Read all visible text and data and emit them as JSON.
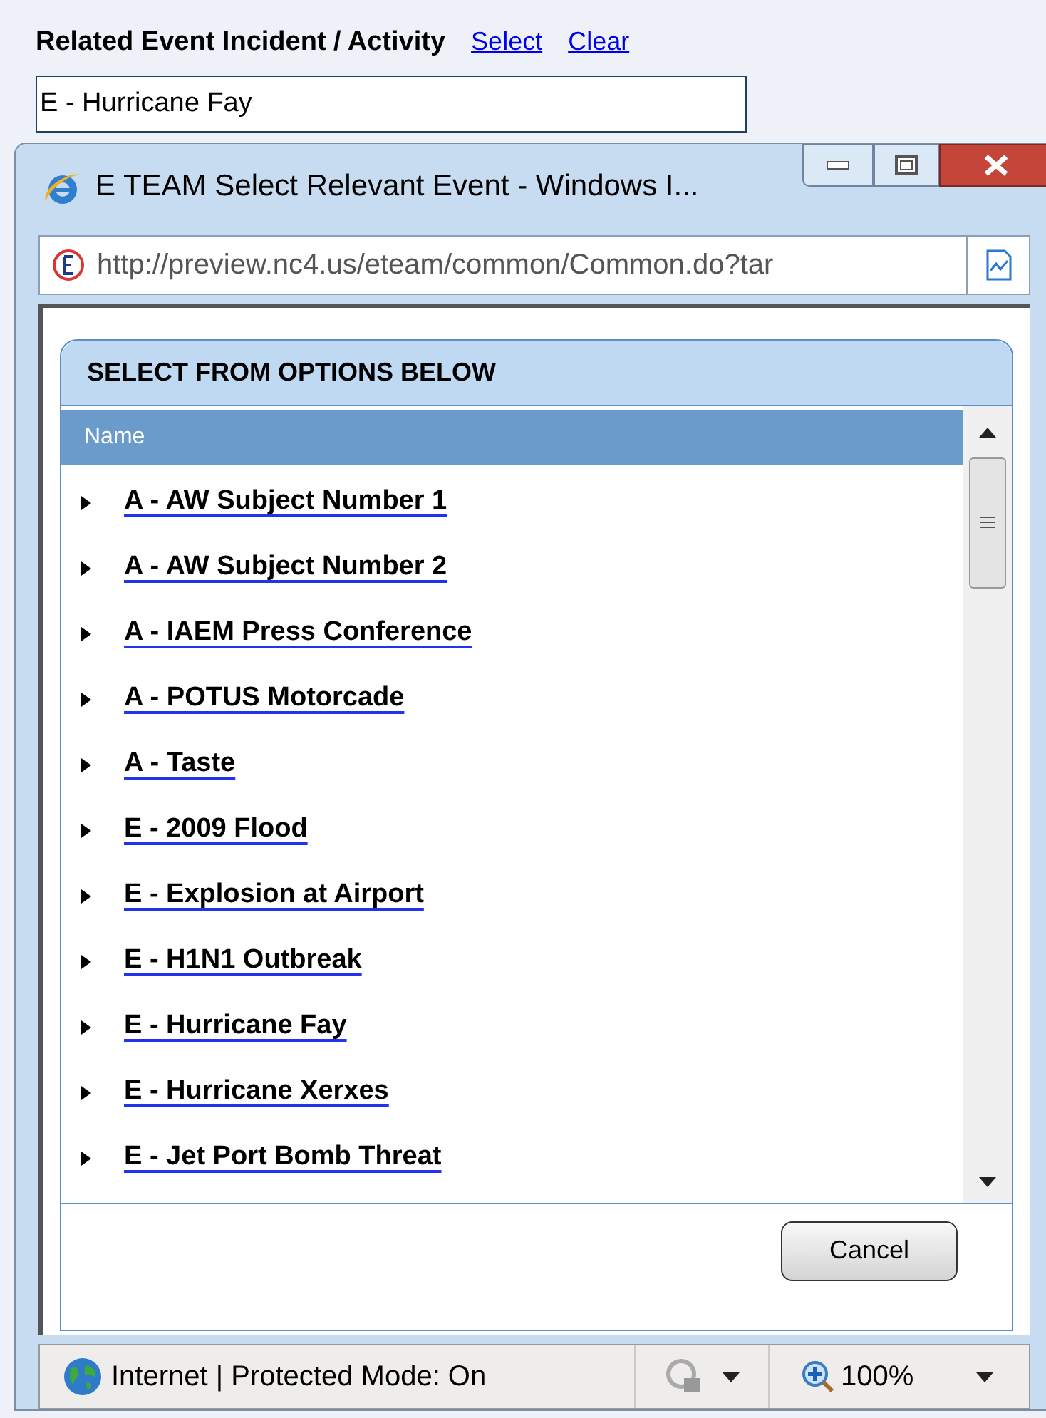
{
  "form": {
    "label": "Related Event Incident / Activity",
    "links": [
      "Select",
      "Clear"
    ],
    "value": "E - Hurricane Fay"
  },
  "window": {
    "title": "E TEAM Select Relevant Event - Windows I...",
    "address": "http://preview.nc4.us/eteam/common/Common.do?tar"
  },
  "panel": {
    "title": "SELECT FROM OPTIONS BELOW",
    "column": "Name",
    "items": [
      {
        "label": "A - AW Subject Number 1",
        "expanded": false
      },
      {
        "label": "A - AW Subject Number 2",
        "expanded": false
      },
      {
        "label": "A - IAEM Press Conference",
        "expanded": false
      },
      {
        "label": "A - POTUS Motorcade",
        "expanded": false
      },
      {
        "label": "A - Taste",
        "expanded": false
      },
      {
        "label": "E - 2009 Flood",
        "expanded": false
      },
      {
        "label": "E - Explosion at Airport",
        "expanded": false
      },
      {
        "label": "E - H1N1 Outbreak",
        "expanded": false
      },
      {
        "label": "E - Hurricane Fay",
        "expanded": false
      },
      {
        "label": "E - Hurricane Xerxes",
        "expanded": false
      },
      {
        "label": "E - Jet Port Bomb Threat",
        "expanded": false
      }
    ],
    "button": "Cancel"
  },
  "status_bar": {
    "zone": "Internet | Protected Mode: On",
    "zoom": "100%"
  }
}
